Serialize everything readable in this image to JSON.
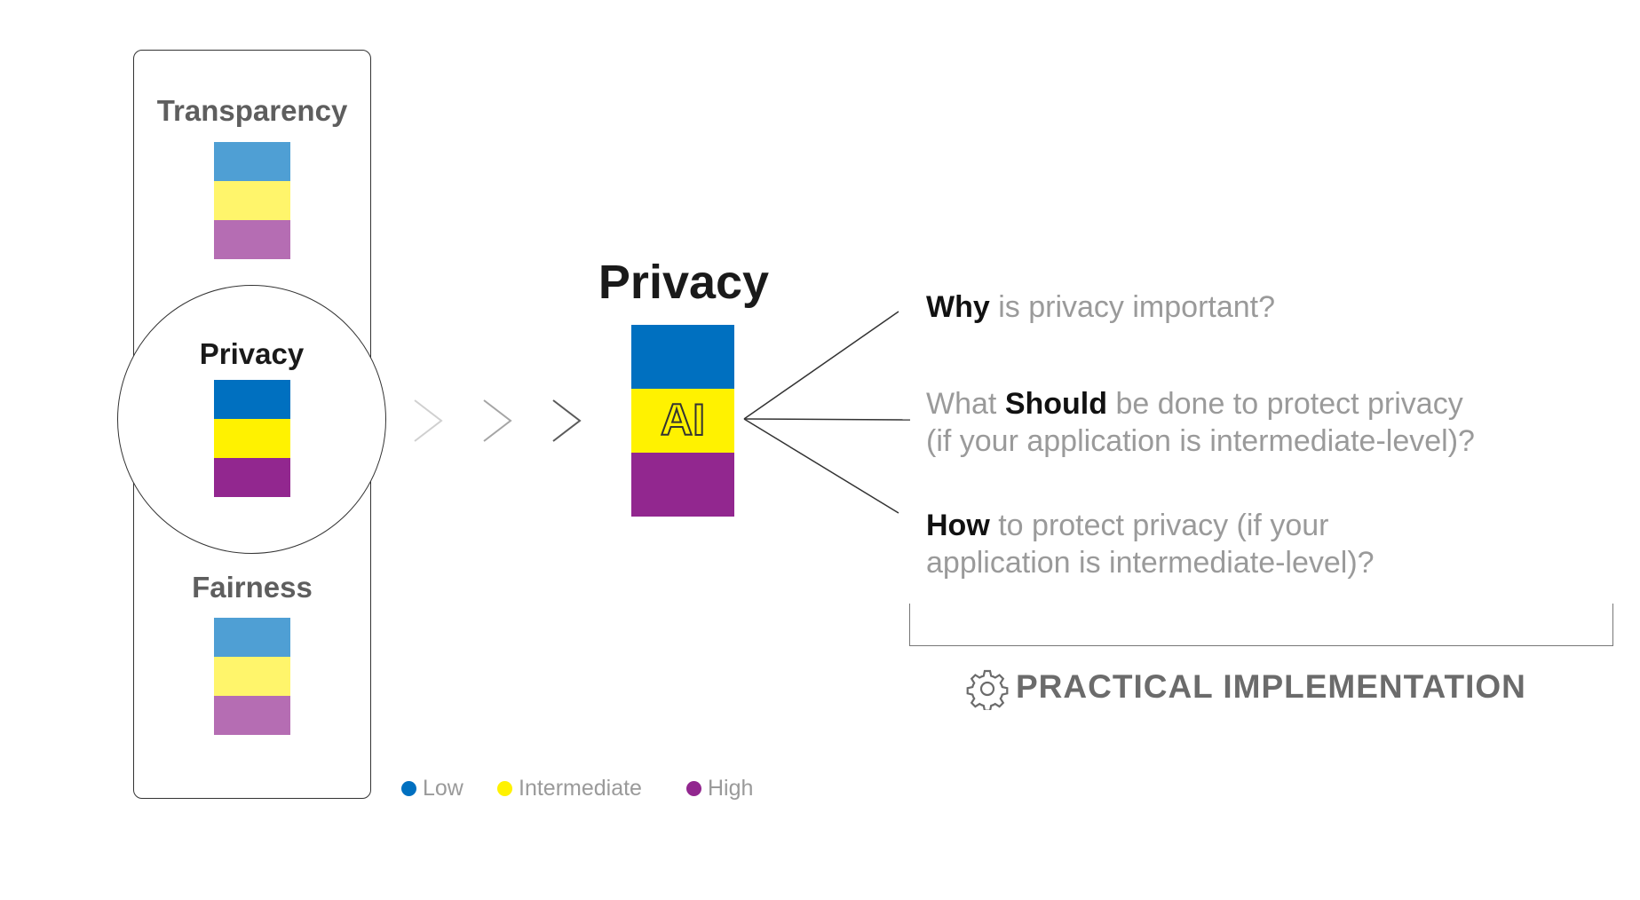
{
  "left_panel": {
    "top_label": "Transparency",
    "highlight_label": "Privacy",
    "bottom_label": "Fairness"
  },
  "center": {
    "title": "Privacy",
    "block_label": "AI"
  },
  "questions": [
    {
      "bold": "Why",
      "rest": " is privacy important?"
    },
    {
      "pre": "What ",
      "bold": "Should",
      "rest": " be done to protect privacy",
      "line2": "(if your application is intermediate-level)?"
    },
    {
      "bold": "How",
      "rest": " to protect privacy (if your",
      "line2": "application is intermediate-level)?"
    }
  ],
  "implementation": {
    "label": "PRACTICAL IMPLEMENTATION",
    "icon": "gear-icon"
  },
  "legend": [
    {
      "label": "Low",
      "color": "#0070c0"
    },
    {
      "label": "Intermediate",
      "color": "#fff200"
    },
    {
      "label": "High",
      "color": "#92278f"
    }
  ],
  "colors": {
    "low": "#0070c0",
    "intermediate": "#fff200",
    "high": "#92278f",
    "low_faded": "#4f9fd4",
    "intermediate_faded": "#fff56b",
    "high_faded": "#b56db3"
  }
}
